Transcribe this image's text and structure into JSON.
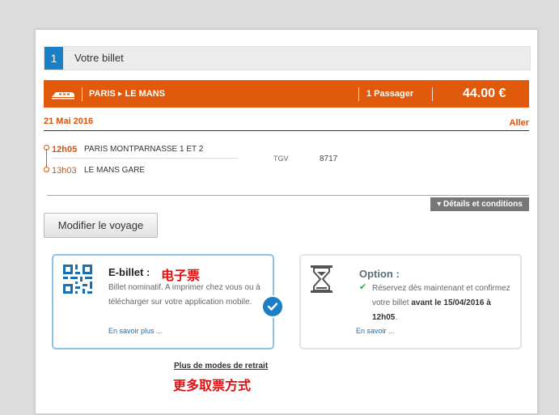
{
  "step": {
    "number": "1",
    "title": "Votre billet"
  },
  "trip": {
    "from": "PARIS",
    "arrow": "▸",
    "to": "LE MANS",
    "passengers": "1 Passager",
    "price": "44.00 €",
    "date": "21 Mai 2016",
    "direction": "Aller",
    "departure": {
      "time": "12h05",
      "station": "PARIS MONTPARNASSE 1 ET 2"
    },
    "arrival": {
      "time": "13h03",
      "station": "LE MANS GARE"
    },
    "train_type": "TGV",
    "train_number": "8717"
  },
  "details_button": "▾ Détails et conditions",
  "modify_button": "Modifier le voyage",
  "ebillet": {
    "title": "E-billet :",
    "chinese_label": "电子票",
    "description": "Billet nominatif. A imprimer chez vous ou à télécharger sur votre application mobile.",
    "link": "En savoir plus ..."
  },
  "option": {
    "title": "Option :",
    "description_part1": "Réservez dès maintenant et confirmez votre billet ",
    "description_bold": "avant le 15/04/2016 à 12h05",
    "description_part2": ".",
    "link": "En savoir ..."
  },
  "more_modes_link": "Plus de modes de retrait",
  "more_modes_chinese": "更多取票方式",
  "colors": {
    "orange": "#e1590b",
    "blue": "#1a7fc4",
    "red_annotation": "#e01010"
  }
}
